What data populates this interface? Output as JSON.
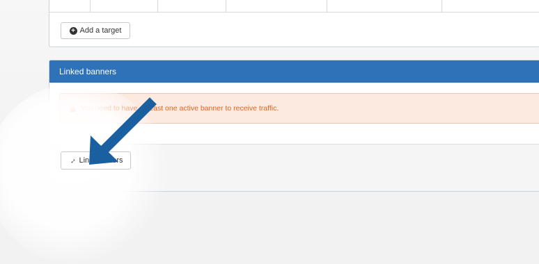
{
  "targets_panel": {
    "add_target_label": "Add a target"
  },
  "linked_banners": {
    "title": "Linked banners",
    "alert_text": "You need to have at least one active banner to receive traffic.",
    "link_button_label": "Link banners"
  },
  "icons": {
    "plus": "plus-circle-icon",
    "warning": "warning-icon",
    "link": "link-icon",
    "arrow": "arrow-annotation-icon"
  },
  "colors": {
    "header_blue": "#2f72b7",
    "alert_bg": "#fce9e0",
    "alert_text": "#e0661f",
    "arrow_blue": "#1a5fa0"
  }
}
